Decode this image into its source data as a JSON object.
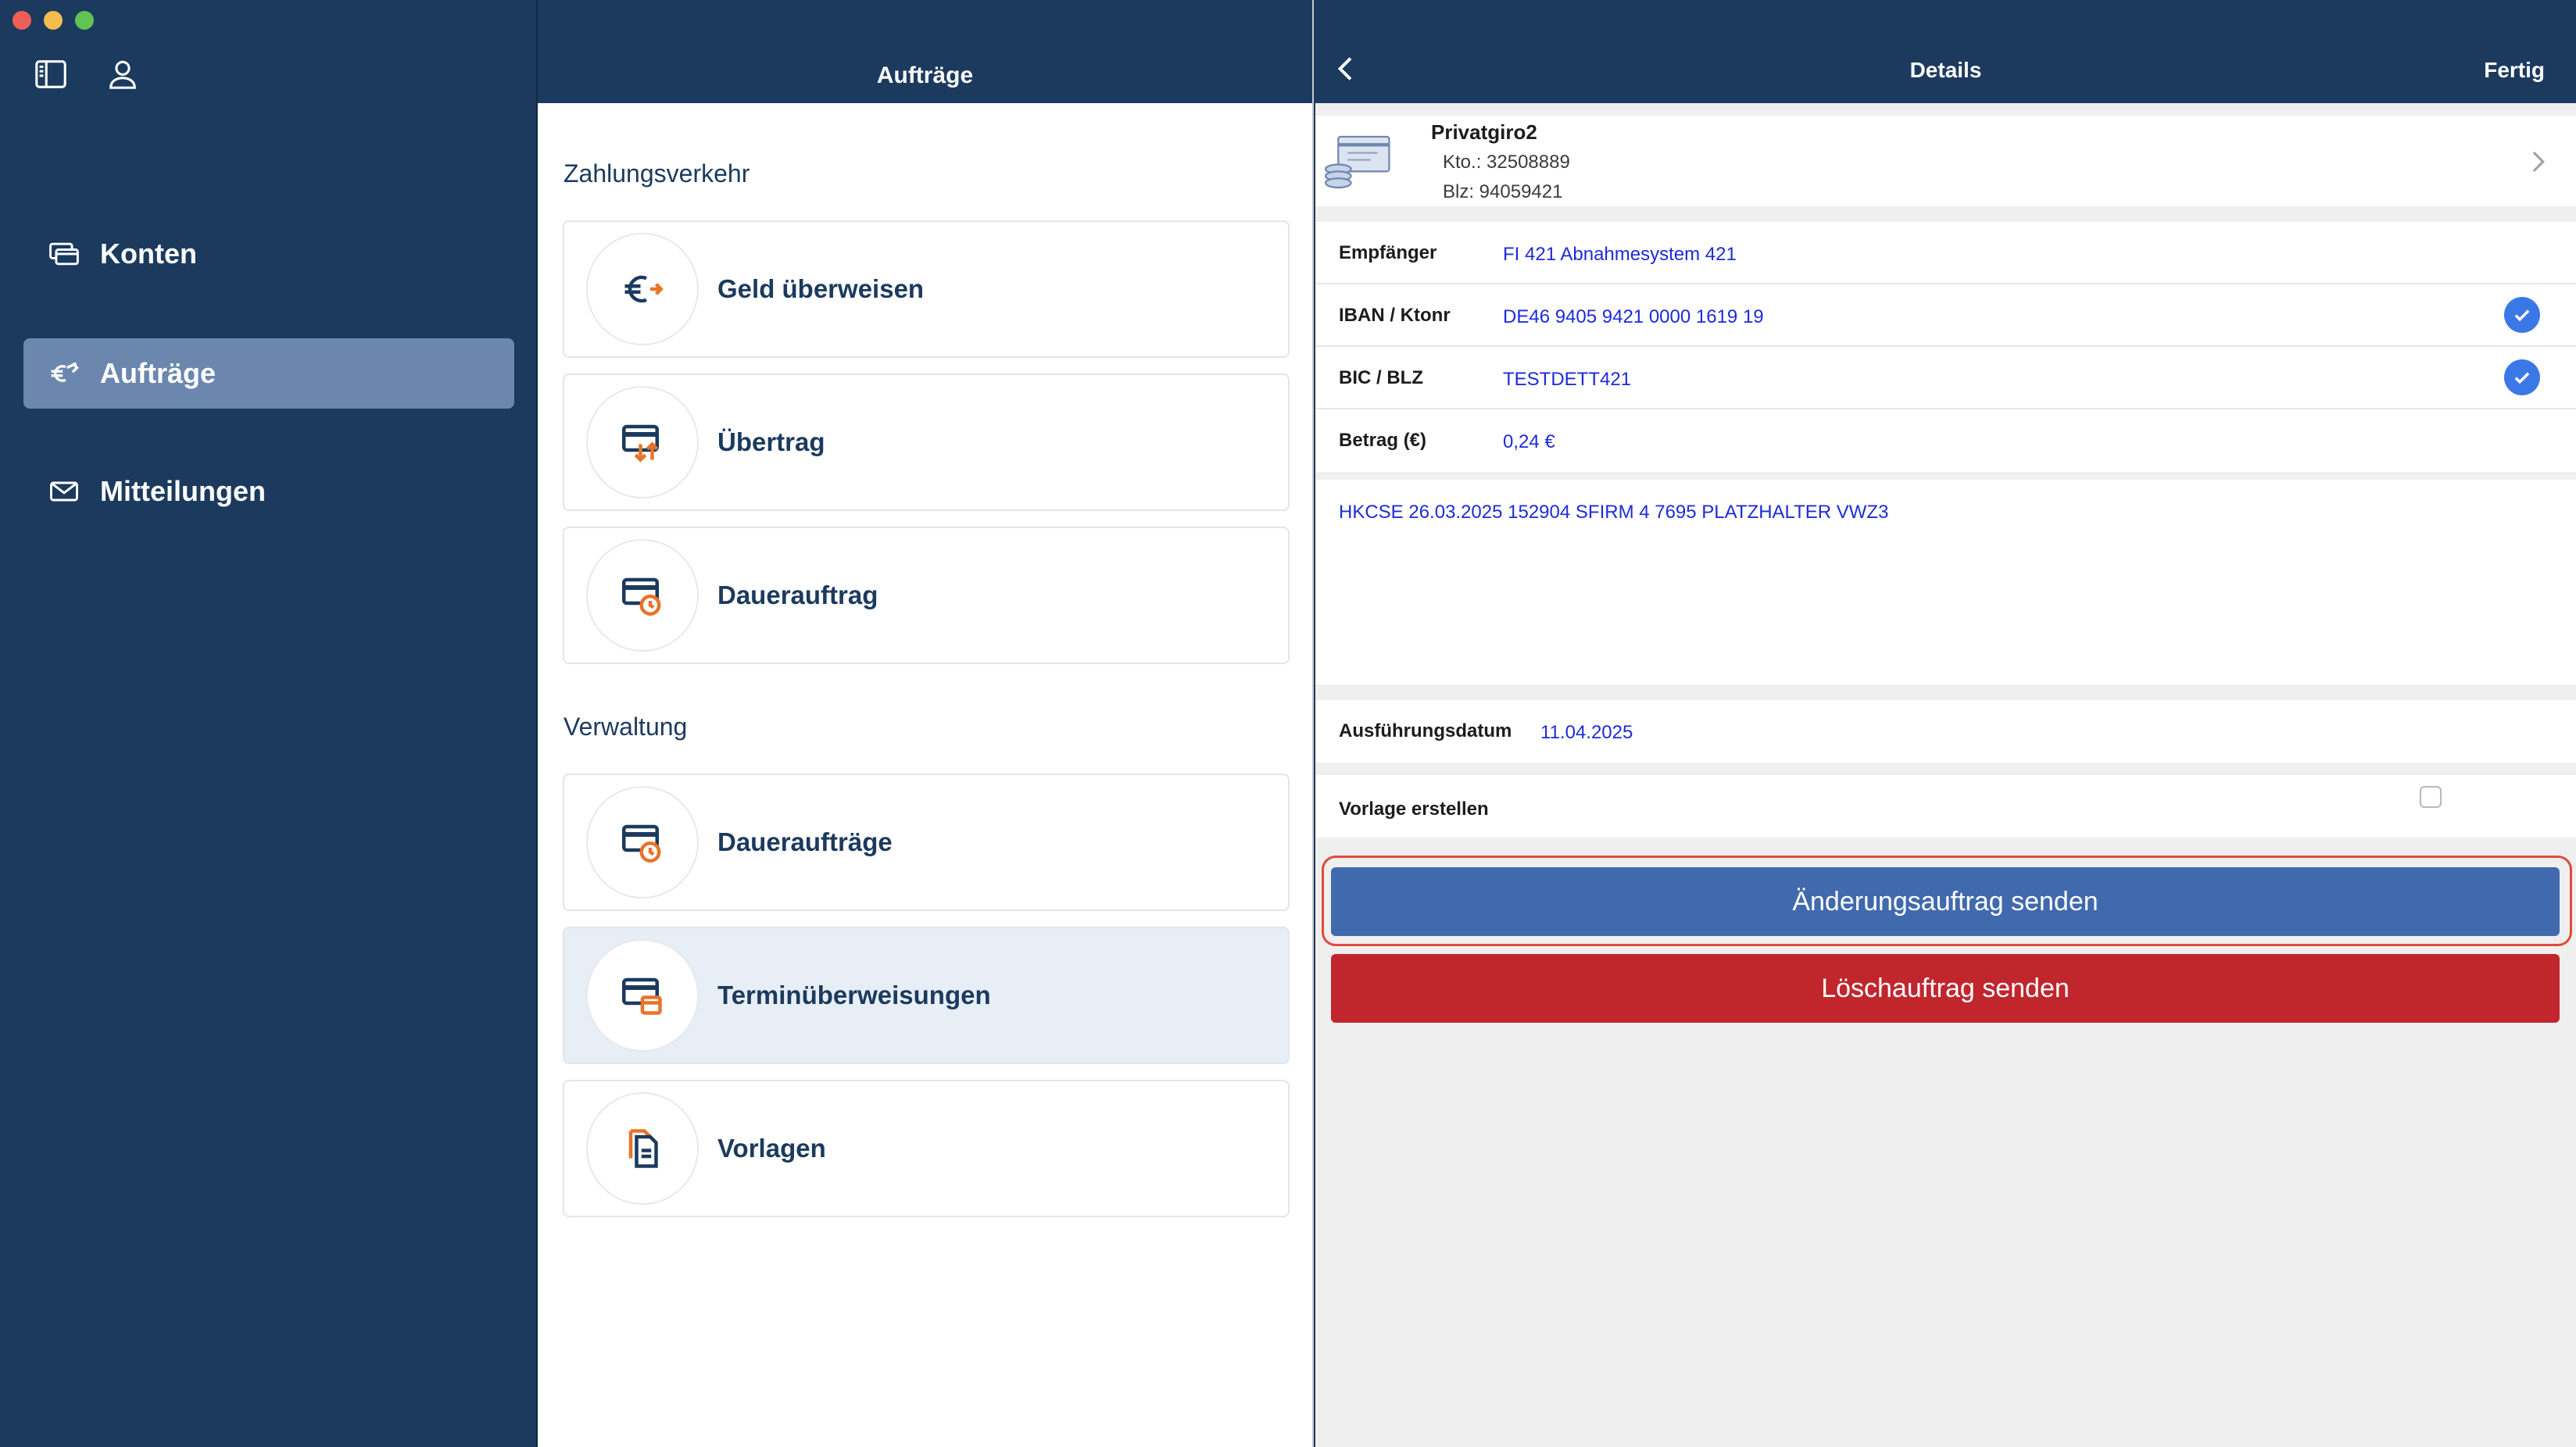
{
  "sidebar": {
    "items": [
      {
        "label": "Konten",
        "icon": "accounts-icon"
      },
      {
        "label": "Aufträge",
        "icon": "transfer-euro-icon"
      },
      {
        "label": "Mitteilungen",
        "icon": "envelope-icon"
      }
    ]
  },
  "middle": {
    "title": "Aufträge",
    "section_payments": "Zahlungsverkehr",
    "section_admin": "Verwaltung",
    "cards": [
      {
        "label": "Geld überweisen",
        "icon": "euro-transfer-icon"
      },
      {
        "label": "Übertrag",
        "icon": "card-transfer-icon"
      },
      {
        "label": "Dauerauftrag",
        "icon": "card-clock-icon"
      },
      {
        "label": "Daueraufträge",
        "icon": "card-clock-icon"
      },
      {
        "label": "Terminüberweisungen",
        "icon": "card-calendar-icon"
      },
      {
        "label": "Vorlagen",
        "icon": "document-icon"
      }
    ]
  },
  "details": {
    "title": "Details",
    "done_label": "Fertig",
    "account": {
      "name": "Privatgiro2",
      "kto": "Kto.: 32508889",
      "blz": "Blz: 94059421"
    },
    "fields": [
      {
        "label": "Empfänger",
        "value": "FI 421 Abnahmesystem 421",
        "verified": false
      },
      {
        "label": "IBAN / Ktonr",
        "value": "DE46 9405 9421 0000 1619 19",
        "verified": true
      },
      {
        "label": "BIC / BLZ",
        "value": "TESTDETT421",
        "verified": true
      },
      {
        "label": "Betrag (€)",
        "value": "0,24 €",
        "verified": false
      }
    ],
    "purpose": "HKCSE 26.03.2025 152904 SFIRM 4 7695 PLATZHALTER VWZ3",
    "execution_label": "Ausführungsdatum",
    "execution_date": "11.04.2025",
    "template_label": "Vorlage erstellen",
    "template_checked": false,
    "change_button": "Änderungsauftrag senden",
    "delete_button": "Löschauftrag senden"
  },
  "colors": {
    "navy": "#1b3a5e",
    "active_nav": "#6b87ae",
    "link_blue": "#1d2bd8",
    "primary_button": "#4169ad",
    "danger_button": "#c1262d",
    "highlight_outline": "#e14a3b"
  }
}
